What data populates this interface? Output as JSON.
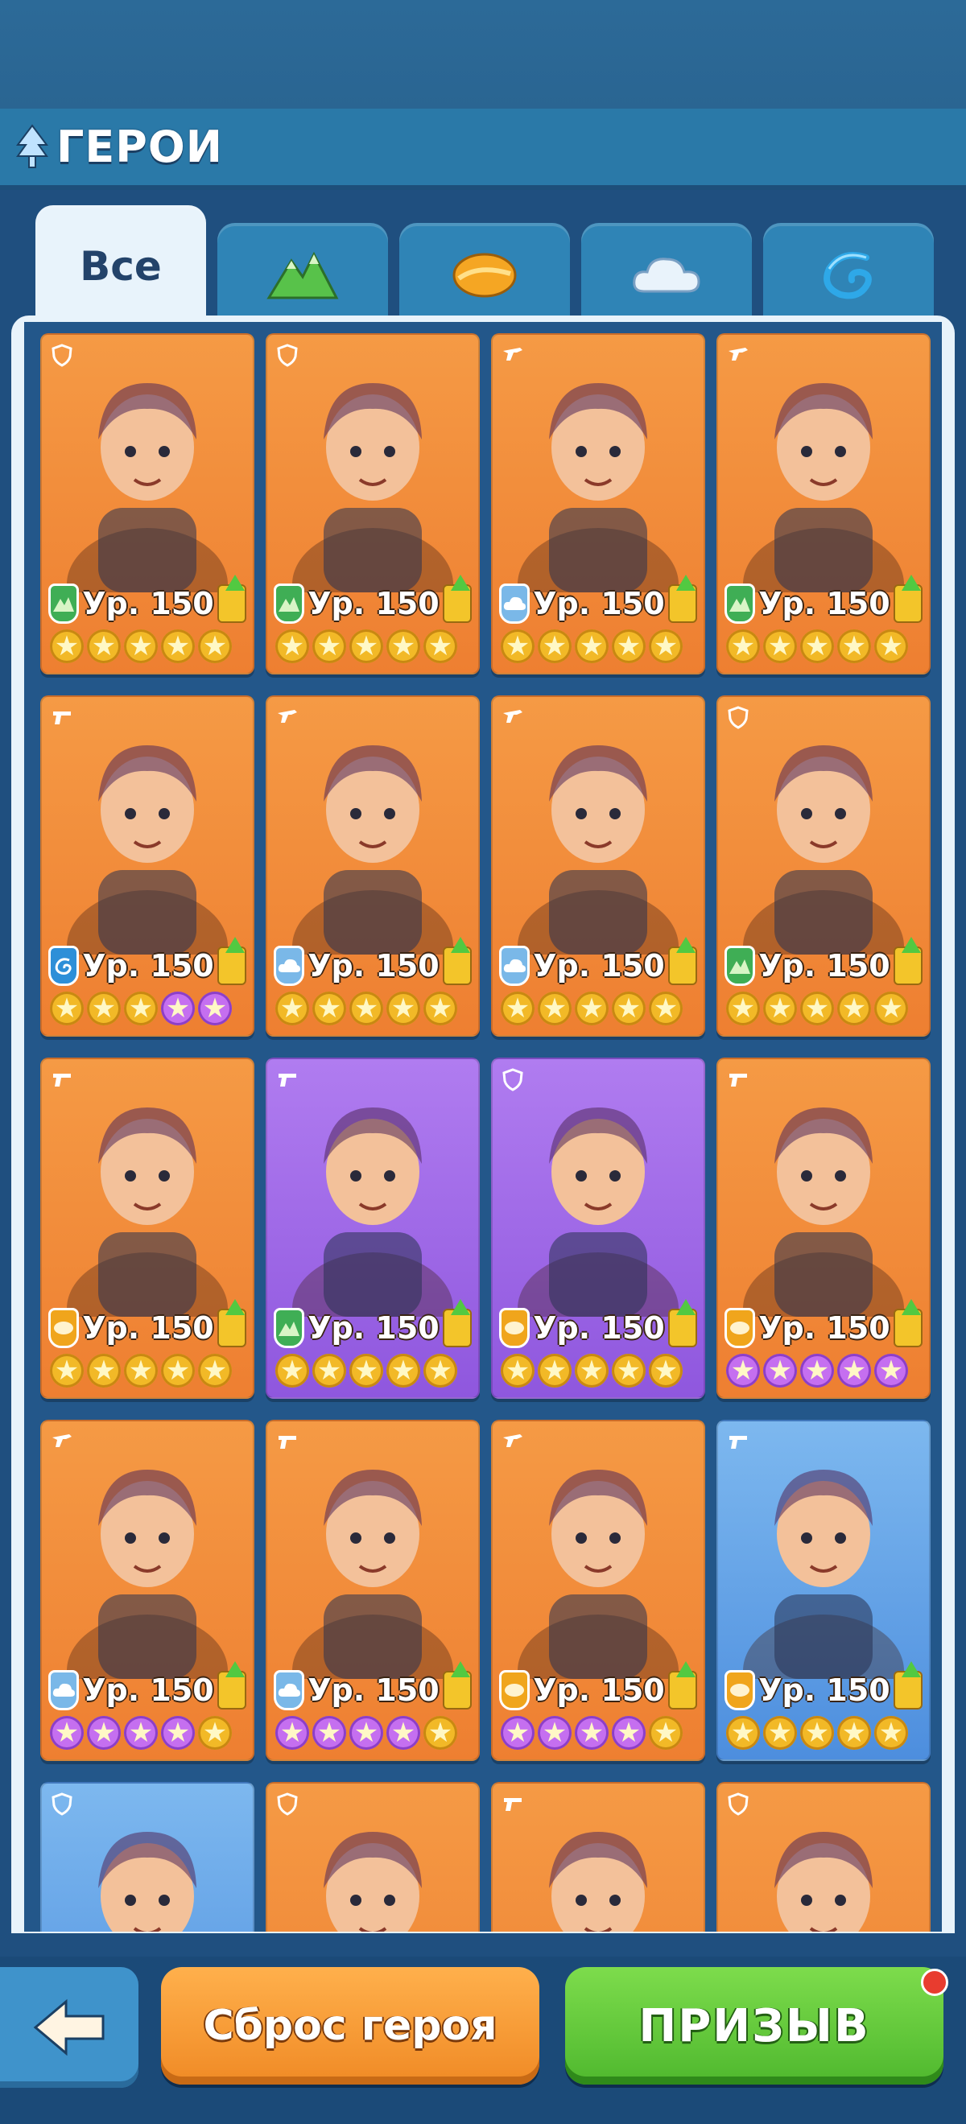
{
  "header": {
    "title": "ГЕРОИ"
  },
  "tabs": [
    {
      "label": "Все",
      "icon": "all",
      "active": true
    },
    {
      "label": "",
      "icon": "mountain-icon",
      "active": false
    },
    {
      "label": "",
      "icon": "desert-icon",
      "active": false
    },
    {
      "label": "",
      "icon": "cloud-icon",
      "active": false
    },
    {
      "label": "",
      "icon": "wave-icon",
      "active": false
    }
  ],
  "heroes": [
    {
      "level": "Ур. 150",
      "role": "shield",
      "element": "forest",
      "bg": "orange",
      "stars": [
        "gold",
        "gold",
        "gold",
        "gold",
        "gold"
      ]
    },
    {
      "level": "Ур. 150",
      "role": "shield",
      "element": "forest",
      "bg": "orange",
      "stars": [
        "gold",
        "gold",
        "gold",
        "gold",
        "gold"
      ]
    },
    {
      "level": "Ур. 150",
      "role": "gun",
      "element": "cloud",
      "bg": "orange",
      "stars": [
        "gold",
        "gold",
        "gold",
        "gold",
        "gold"
      ]
    },
    {
      "level": "Ур. 150",
      "role": "gun",
      "element": "forest",
      "bg": "orange",
      "stars": [
        "gold",
        "gold",
        "gold",
        "gold",
        "gold"
      ]
    },
    {
      "level": "Ур. 150",
      "role": "pistol",
      "element": "ocean",
      "bg": "orange",
      "stars": [
        "gold",
        "gold",
        "gold",
        "purple",
        "purple"
      ]
    },
    {
      "level": "Ур. 150",
      "role": "gun",
      "element": "cloud",
      "bg": "orange",
      "stars": [
        "gold",
        "gold",
        "gold",
        "gold",
        "gold"
      ]
    },
    {
      "level": "Ур. 150",
      "role": "gun",
      "element": "cloud",
      "bg": "orange",
      "stars": [
        "gold",
        "gold",
        "gold",
        "gold",
        "gold"
      ]
    },
    {
      "level": "Ур. 150",
      "role": "shield",
      "element": "forest",
      "bg": "orange",
      "stars": [
        "gold",
        "gold",
        "gold",
        "gold",
        "gold"
      ]
    },
    {
      "level": "Ур. 150",
      "role": "pistol",
      "element": "desert",
      "bg": "orange",
      "stars": [
        "gold",
        "gold",
        "gold",
        "gold",
        "gold"
      ]
    },
    {
      "level": "Ур. 150",
      "role": "pistol",
      "element": "forest",
      "bg": "purple",
      "stars": [
        "gold",
        "gold",
        "gold",
        "gold",
        "gold"
      ]
    },
    {
      "level": "Ур. 150",
      "role": "shield",
      "element": "desert",
      "bg": "purple",
      "stars": [
        "gold",
        "gold",
        "gold",
        "gold",
        "gold"
      ]
    },
    {
      "level": "Ур. 150",
      "role": "pistol",
      "element": "desert",
      "bg": "orange",
      "stars": [
        "purple",
        "purple",
        "purple",
        "purple",
        "purple"
      ]
    },
    {
      "level": "Ур. 150",
      "role": "gun",
      "element": "cloud",
      "bg": "orange",
      "stars": [
        "purple",
        "purple",
        "purple",
        "purple",
        "gold"
      ]
    },
    {
      "level": "Ур. 150",
      "role": "pistol",
      "element": "cloud",
      "bg": "orange",
      "stars": [
        "purple",
        "purple",
        "purple",
        "purple",
        "gold"
      ]
    },
    {
      "level": "Ур. 150",
      "role": "gun",
      "element": "desert",
      "bg": "orange",
      "stars": [
        "purple",
        "purple",
        "purple",
        "purple",
        "gold"
      ]
    },
    {
      "level": "Ур. 150",
      "role": "pistol",
      "element": "desert",
      "bg": "blue",
      "stars": [
        "gold",
        "gold",
        "gold",
        "gold",
        "gold"
      ]
    },
    {
      "level": "",
      "role": "shield",
      "element": "",
      "bg": "blue",
      "stars": []
    },
    {
      "level": "",
      "role": "shield",
      "element": "",
      "bg": "orange",
      "stars": []
    },
    {
      "level": "",
      "role": "pistol",
      "element": "",
      "bg": "orange",
      "stars": []
    },
    {
      "level": "",
      "role": "shield",
      "element": "",
      "bg": "orange",
      "stars": []
    }
  ],
  "bottom": {
    "reset_label": "Сброс героя",
    "summon_label": "ПРИЗЫВ"
  }
}
